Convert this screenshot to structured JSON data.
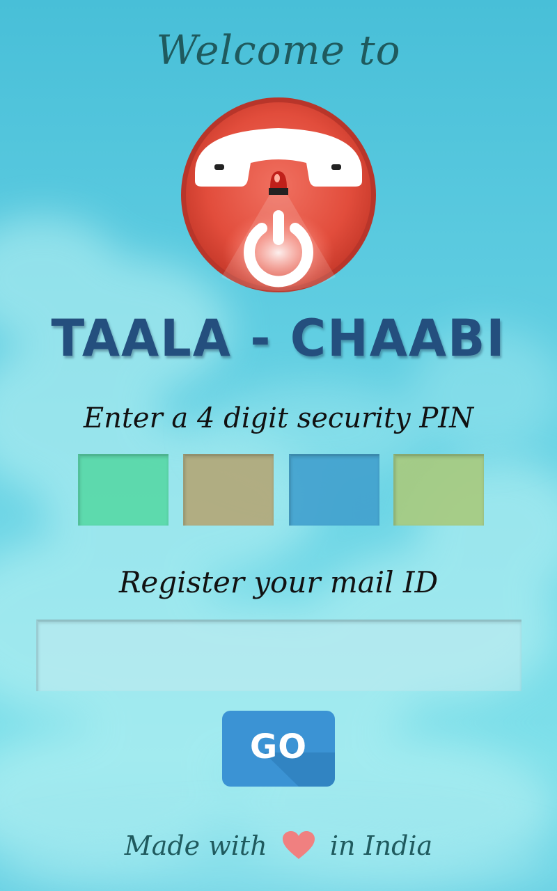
{
  "header": {
    "welcome_text": "Welcome to"
  },
  "logo": {
    "icon": "phone-lock-icon",
    "colors": {
      "circle": "#e8503f",
      "rim": "#c63a2c",
      "handset": "#ffffff",
      "siren": "#c0201a"
    }
  },
  "app_name": "TAALA - CHAABI",
  "pin": {
    "label": "Enter a 4 digit security PIN",
    "boxes": [
      {
        "digit": "",
        "color": "#58d9a8"
      },
      {
        "digit": "",
        "color": "#b3a97a"
      },
      {
        "digit": "",
        "color": "#43a2cf"
      },
      {
        "digit": "",
        "color": "#a8cb80"
      }
    ]
  },
  "mail": {
    "label": "Register your mail ID",
    "value": "",
    "placeholder": ""
  },
  "go_button": {
    "label": "GO",
    "color": "#3b93d4"
  },
  "footer": {
    "prefix": "Made with",
    "icon": "heart-icon",
    "suffix": "in India",
    "heart_color": "#f08080"
  }
}
